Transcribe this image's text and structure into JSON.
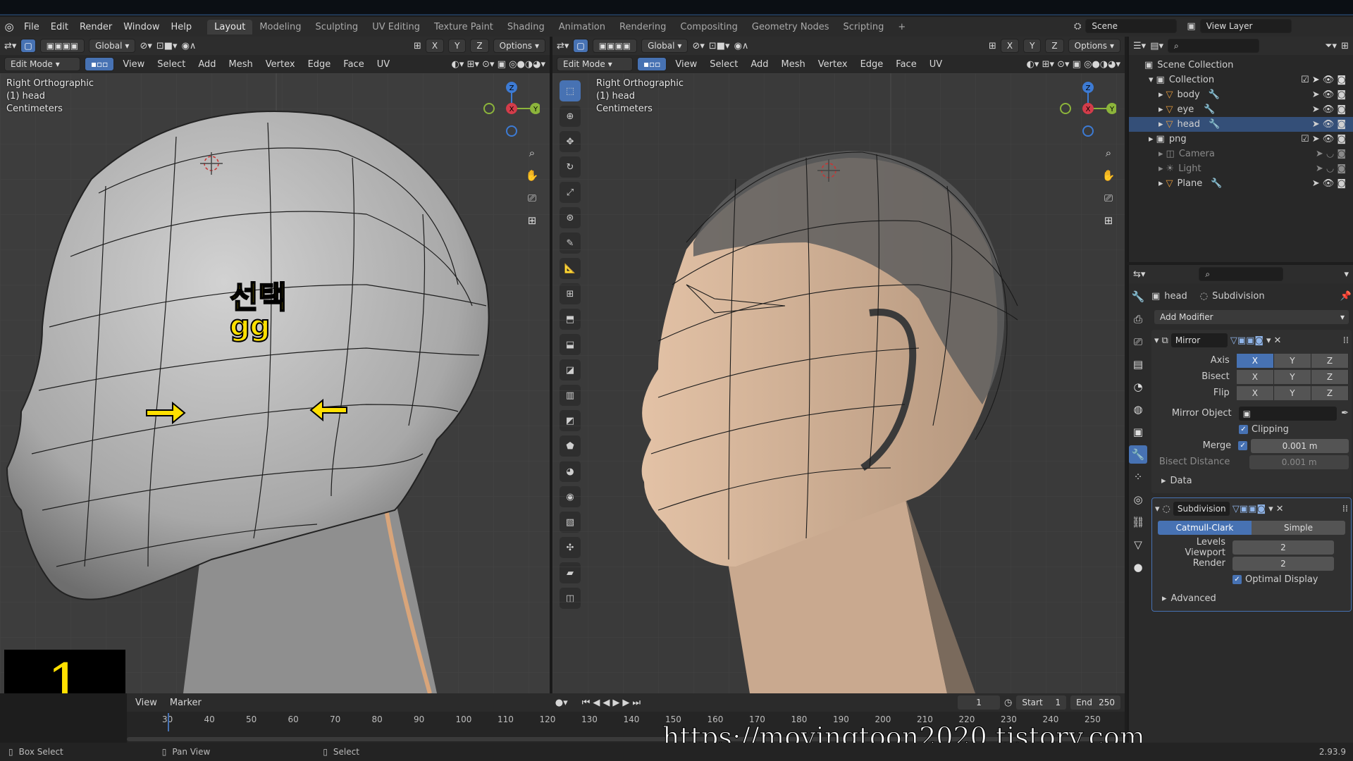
{
  "menu": {
    "items": [
      "File",
      "Edit",
      "Render",
      "Window",
      "Help"
    ],
    "workspaces": [
      "Layout",
      "Modeling",
      "Sculpting",
      "UV Editing",
      "Texture Paint",
      "Shading",
      "Animation",
      "Rendering",
      "Compositing",
      "Geometry Nodes",
      "Scripting"
    ],
    "active_workspace": "Layout",
    "add_tab": "+",
    "scene": "Scene",
    "view_layer": "View Layer"
  },
  "viewport_left": {
    "transform": "Global",
    "options": "Options",
    "mode": "Edit Mode",
    "menus": [
      "View",
      "Select",
      "Add",
      "Mesh",
      "Vertex",
      "Edge",
      "Face",
      "UV"
    ],
    "axes": [
      "X",
      "Y",
      "Z"
    ],
    "overlay_title": "Right Orthographic",
    "overlay_object": "(1) head",
    "overlay_units": "Centimeters",
    "annotation_korean": "선택",
    "annotation_keys": "gg",
    "corner_number": "1"
  },
  "viewport_right": {
    "transform": "Global",
    "options": "Options",
    "mode": "Edit Mode",
    "menus": [
      "View",
      "Select",
      "Add",
      "Mesh",
      "Vertex",
      "Edge",
      "Face",
      "UV"
    ],
    "axes": [
      "X",
      "Y",
      "Z"
    ],
    "overlay_title": "Right Orthographic",
    "overlay_object": "(1) head",
    "overlay_units": "Centimeters"
  },
  "gizmo": {
    "z": "Z",
    "y": "Y",
    "x": "X"
  },
  "outliner": {
    "root": "Scene Collection",
    "collection": "Collection",
    "items": [
      {
        "name": "body",
        "icon": "mesh-icon",
        "selected": false,
        "dim": false
      },
      {
        "name": "eye",
        "icon": "mesh-icon",
        "selected": false,
        "dim": false
      },
      {
        "name": "head",
        "icon": "mesh-icon",
        "selected": true,
        "dim": false
      },
      {
        "name": "png",
        "icon": "collection-icon",
        "selected": false,
        "dim": false
      },
      {
        "name": "Camera",
        "icon": "camera-icon",
        "selected": false,
        "dim": true
      },
      {
        "name": "Light",
        "icon": "light-icon",
        "selected": false,
        "dim": true
      },
      {
        "name": "Plane",
        "icon": "mesh-icon",
        "selected": false,
        "dim": false
      }
    ]
  },
  "properties": {
    "object": "head",
    "modifier_context": "Subdivision",
    "add_modifier": "Add Modifier",
    "mirror": {
      "name": "Mirror",
      "axis_label": "Axis",
      "bisect_label": "Bisect",
      "flip_label": "Flip",
      "xyz": [
        "X",
        "Y",
        "Z"
      ],
      "mirror_object_label": "Mirror Object",
      "clipping": "Clipping",
      "merge_label": "Merge",
      "merge_value": "0.001 m",
      "bisect_distance_label": "Bisect Distance",
      "bisect_distance_value": "0.001 m",
      "data": "Data"
    },
    "subdivision": {
      "name": "Subdivision",
      "catmull": "Catmull-Clark",
      "simple": "Simple",
      "levels_label": "Levels Viewport",
      "levels_value": "2",
      "render_label": "Render",
      "render_value": "2",
      "optimal": "Optimal Display",
      "advanced": "Advanced"
    }
  },
  "timeline": {
    "view": "View",
    "marker": "Marker",
    "current_frame": "1",
    "start_label": "Start",
    "start_value": "1",
    "end_label": "End",
    "end_value": "250",
    "ticks": [
      "30",
      "40",
      "50",
      "60",
      "70",
      "80",
      "90",
      "100",
      "110",
      "120",
      "130",
      "140",
      "150",
      "160",
      "170",
      "180",
      "190",
      "200",
      "210",
      "220",
      "230",
      "240",
      "250"
    ]
  },
  "status": {
    "box_select": "Box Select",
    "pan_view": "Pan View",
    "select": "Select",
    "version": "2.93.9"
  },
  "watermark": "https://movingtoon2020.tistory.com",
  "colors": {
    "accent": "#4772b3",
    "annotation_yellow": "#ffe000",
    "skin": "#d8b89c"
  }
}
